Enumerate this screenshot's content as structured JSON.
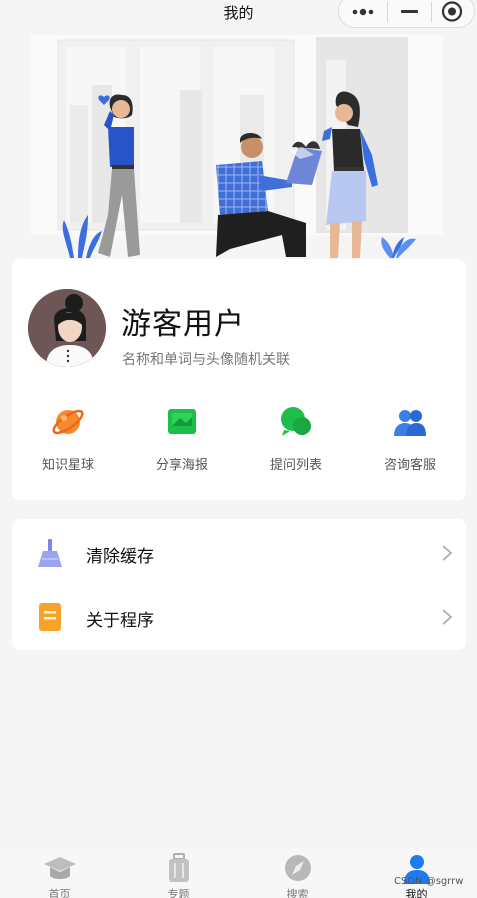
{
  "nav": {
    "title": "我的"
  },
  "profile": {
    "name": "游客用户",
    "subtitle": "名称和单词与头像随机关联"
  },
  "shortcuts": [
    {
      "label": "知识星球",
      "icon": "planet-icon"
    },
    {
      "label": "分享海报",
      "icon": "image-icon"
    },
    {
      "label": "提问列表",
      "icon": "chat-bubbles-icon"
    },
    {
      "label": "咨询客服",
      "icon": "customer-service-icon"
    }
  ],
  "menu": [
    {
      "label": "清除缓存",
      "icon": "broom-icon"
    },
    {
      "label": "关于程序",
      "icon": "document-icon"
    }
  ],
  "tabs": [
    {
      "label": "首页",
      "icon": "graduation-cap-icon",
      "active": false
    },
    {
      "label": "专题",
      "icon": "luggage-icon",
      "active": false
    },
    {
      "label": "搜索",
      "icon": "compass-icon",
      "active": false
    },
    {
      "label": "我的",
      "icon": "person-icon",
      "active": true
    }
  ],
  "watermark": "CSDN @sgrrw",
  "colors": {
    "accent": "#1e7cf0",
    "background": "#f5f5f5"
  }
}
